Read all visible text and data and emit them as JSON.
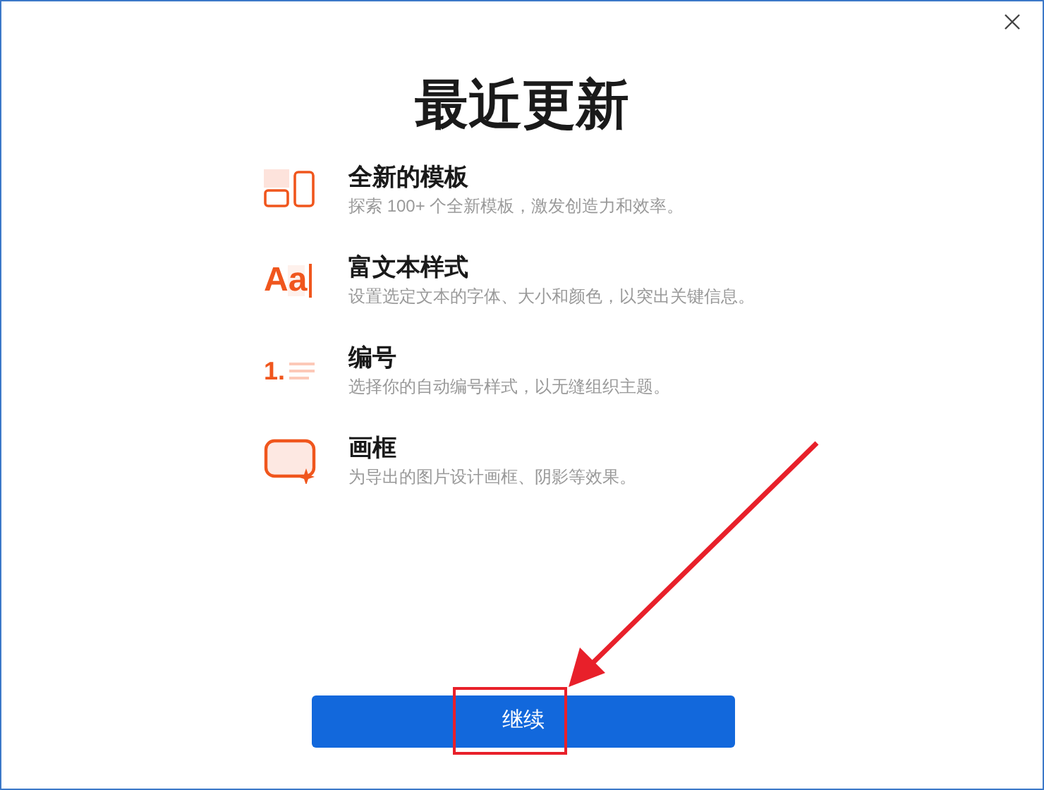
{
  "title": "最近更新",
  "features": [
    {
      "kind": "templates",
      "title": "全新的模板",
      "description": "探索 100+ 个全新模板，激发创造力和效率。"
    },
    {
      "kind": "text-style",
      "title": "富文本样式",
      "description": "设置选定文本的字体、大小和颜色，以突出关键信息。",
      "icon_text": "Aa"
    },
    {
      "kind": "numbering",
      "title": "编号",
      "description": "选择你的自动编号样式，以无缝组织主题。",
      "icon_text": "1."
    },
    {
      "kind": "frame",
      "title": "画框",
      "description": "为导出的图片设计画框、阴影等效果。"
    }
  ],
  "button": "继续"
}
